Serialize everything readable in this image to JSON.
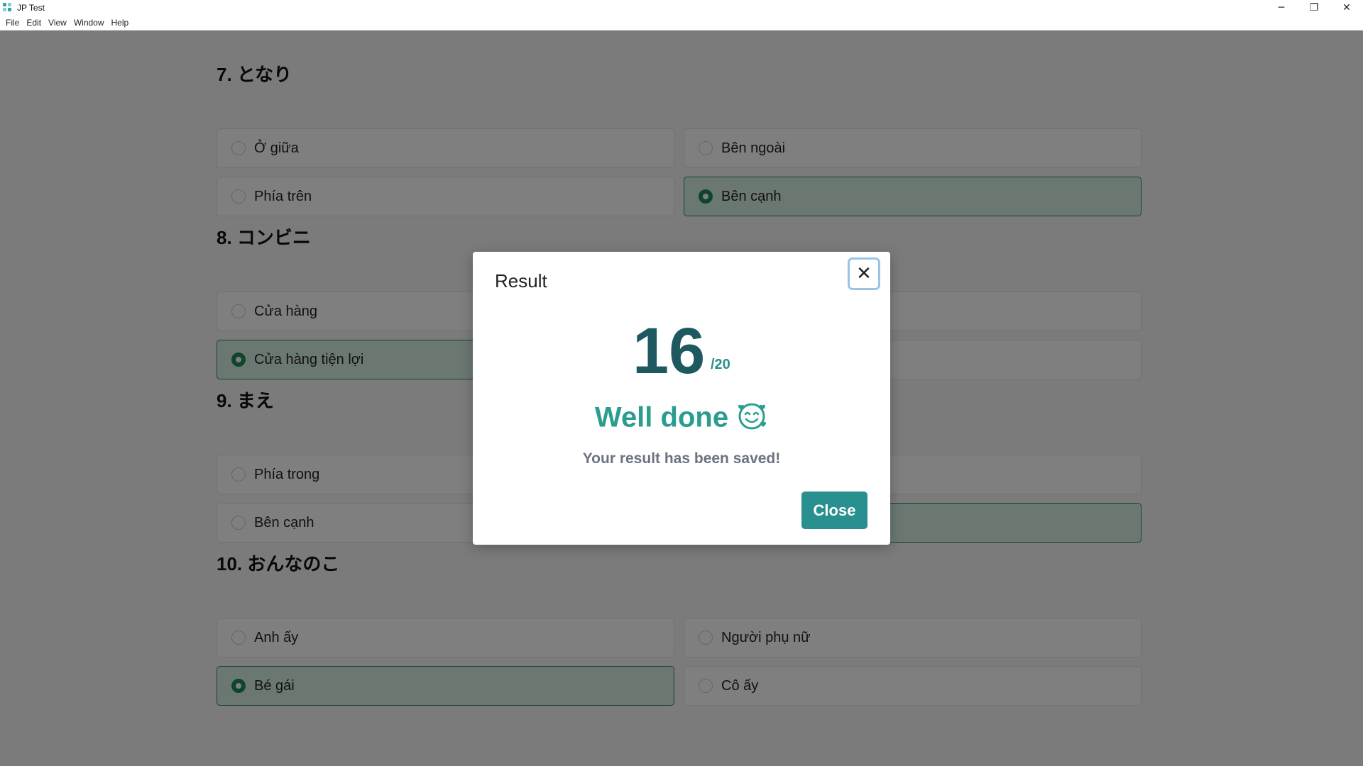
{
  "window": {
    "title": "JP Test",
    "controls": {
      "minimize": "─",
      "maximize": "❐",
      "close": "✕"
    }
  },
  "menu": [
    "File",
    "Edit",
    "View",
    "Window",
    "Help"
  ],
  "questions": [
    {
      "title": "7. となり",
      "options": [
        {
          "label": "Ở giữa",
          "selected": false
        },
        {
          "label": "Bên ngoài",
          "selected": false
        },
        {
          "label": "Phía trên",
          "selected": false
        },
        {
          "label": "Bên cạnh",
          "selected": true
        }
      ]
    },
    {
      "title": "8. コンビニ",
      "options": [
        {
          "label": "Cửa hàng",
          "selected": false
        },
        {
          "label": "",
          "selected": false
        },
        {
          "label": "Cửa hàng tiện lợi",
          "selected": true
        },
        {
          "label": "",
          "selected": false
        }
      ]
    },
    {
      "title": "9. まえ",
      "options": [
        {
          "label": "Phía trong",
          "selected": false
        },
        {
          "label": "",
          "selected": false
        },
        {
          "label": "Bên cạnh",
          "selected": false
        },
        {
          "label": "",
          "selected": true
        }
      ]
    },
    {
      "title": "10. おんなのこ",
      "options": [
        {
          "label": "Anh ấy",
          "selected": false
        },
        {
          "label": "Người phụ nữ",
          "selected": false
        },
        {
          "label": "Bé gái",
          "selected": true
        },
        {
          "label": "Cô ấy",
          "selected": false
        }
      ]
    }
  ],
  "modal": {
    "title": "Result",
    "close_icon": "✕",
    "score": "16",
    "total": "/20",
    "message": "Well done",
    "emoji_icon": "smiling-face-with-hearts-icon",
    "saved_text": "Your result has been saved!",
    "close_label": "Close"
  },
  "colors": {
    "accent": "#2a8f8f",
    "score": "#1e5961",
    "selected_bg": "#d7f0e2",
    "selected_radio": "#1f8a55"
  }
}
